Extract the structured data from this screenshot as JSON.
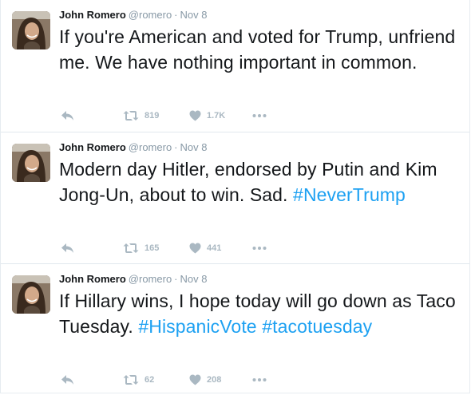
{
  "colors": {
    "name": "#14171a",
    "meta": "#8899a6",
    "hashtag": "#1da1f2",
    "action": "#aab8c2",
    "divider": "#e1e8ed"
  },
  "tweets": [
    {
      "author_name": "John Romero",
      "handle": "@romero",
      "separator": "·",
      "time": "Nov 8",
      "text": "If you're American and voted for Trump, unfriend me. We have nothing important in common.",
      "hashtags": [],
      "retweets": "819",
      "likes": "1.7K",
      "icons": [
        "reply-icon",
        "retweet-icon",
        "heart-icon",
        "more-icon"
      ]
    },
    {
      "author_name": "John Romero",
      "handle": "@romero",
      "separator": "·",
      "time": "Nov 8",
      "text": "Modern day Hitler, endorsed by Putin and Kim Jong-Un, about to win. Sad.",
      "hashtags": [
        "#NeverTrump"
      ],
      "retweets": "165",
      "likes": "441",
      "icons": [
        "reply-icon",
        "retweet-icon",
        "heart-icon",
        "more-icon"
      ]
    },
    {
      "author_name": "John Romero",
      "handle": "@romero",
      "separator": "·",
      "time": "Nov 8",
      "text": "If Hillary wins, I hope today will go down as Taco Tuesday.",
      "hashtags": [
        "#HispanicVote",
        "#tacotuesday"
      ],
      "retweets": "62",
      "likes": "208",
      "icons": [
        "reply-icon",
        "retweet-icon",
        "heart-icon",
        "more-icon"
      ]
    }
  ]
}
